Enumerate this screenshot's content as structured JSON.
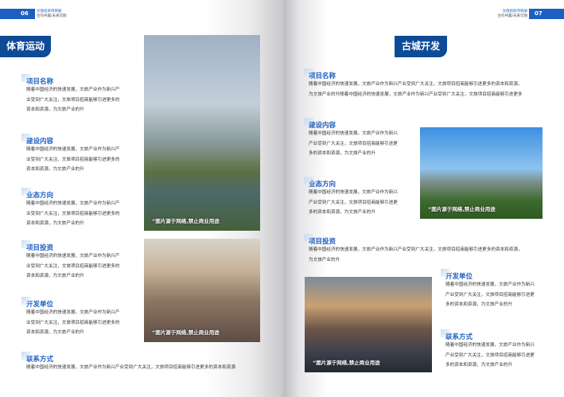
{
  "header": {
    "title": "文旅招商项目册",
    "subtitle": "合作共赢/未来可期",
    "left_page": "06",
    "right_page": "07"
  },
  "left": {
    "section": "体育运动",
    "blocks": [
      {
        "title": "项目名称",
        "lines": [
          "随着中国经济的快速发展，文旅产业作为新兴产",
          "业受到广大关注，文旅项目招商能够引进更多的",
          "资本和资源，为文旅产业的升"
        ]
      },
      {
        "title": "建设内容",
        "lines": [
          "随着中国经济的快速发展，文旅产业作为新兴产",
          "业受到广大关注，文旅项目招商能够引进更多的",
          "资本和资源，为文旅产业的升"
        ]
      },
      {
        "title": "业态方向",
        "lines": [
          "随着中国经济的快速发展，文旅产业作为新兴产",
          "业受到广大关注，文旅项目招商能够引进更多的",
          "资本和资源，为文旅产业的升"
        ]
      },
      {
        "title": "项目投资",
        "lines": [
          "随着中国经济的快速发展，文旅产业作为新兴产",
          "业受到广大关注，文旅项目招商能够引进更多的",
          "资本和资源，为文旅产业的升"
        ]
      },
      {
        "title": "开发单位",
        "lines": [
          "随着中国经济的快速发展，文旅产业作为新兴产",
          "业受到广大关注，文旅项目招商能够引进更多的",
          "资本和资源，为文旅产业的升"
        ]
      },
      {
        "title": "联系方式",
        "lines": [
          "随着中国经济的快速发展，文旅产业作为新兴产业受到广大关注，文旅项目招商能够引进更多的资本和资源"
        ]
      }
    ]
  },
  "right": {
    "section": "古城开发",
    "blocks": [
      {
        "title": "项目名称",
        "lines": [
          "随着中国经济的快速发展，文旅产业作为新兴产业受到广大关注，文旅项目招商能够引进更多的资本和资源，",
          "为文旅产业的升随着中国经济的快速发展，文旅产业作为新兴产业受到广大关注，文旅项目招商能够引进更多"
        ]
      },
      {
        "title": "建设内容",
        "lines": [
          "随着中国经济的快速发展，文旅产业作为新兴",
          "产业受到广大关注，文旅项目招商能够引进更",
          "多的资本和资源，为文旅产业的升"
        ]
      },
      {
        "title": "业态方向",
        "lines": [
          "随着中国经济的快速发展，文旅产业作为新兴",
          "产业受到广大关注，文旅项目招商能够引进更",
          "多的资本和资源，为文旅产业的升"
        ]
      },
      {
        "title": "项目投资",
        "lines": [
          "随着中国经济的快速发展，文旅产业作为新兴产业受到广大关注，文旅项目招商能够引进更多的资本和资源，",
          "为文旅产业的升"
        ]
      },
      {
        "title": "开发单位",
        "lines": [
          "随着中国经济的快速发展，文旅产业作为新兴",
          "产业受到广大关注，文旅项目招商能够引进更",
          "多的资本和资源，为文旅产业的升"
        ]
      },
      {
        "title": "联系方式",
        "lines": [
          "随着中国经济的快速发展，文旅产业作为新兴",
          "产业受到广大关注，文旅项目招商能够引进更",
          "多的资本和资源，为文旅产业的升"
        ]
      }
    ]
  },
  "caption": "“图片源于网络,禁止商业用途",
  "colors": {
    "accent": "#1d5fc0",
    "tag": "#0f4a96"
  }
}
